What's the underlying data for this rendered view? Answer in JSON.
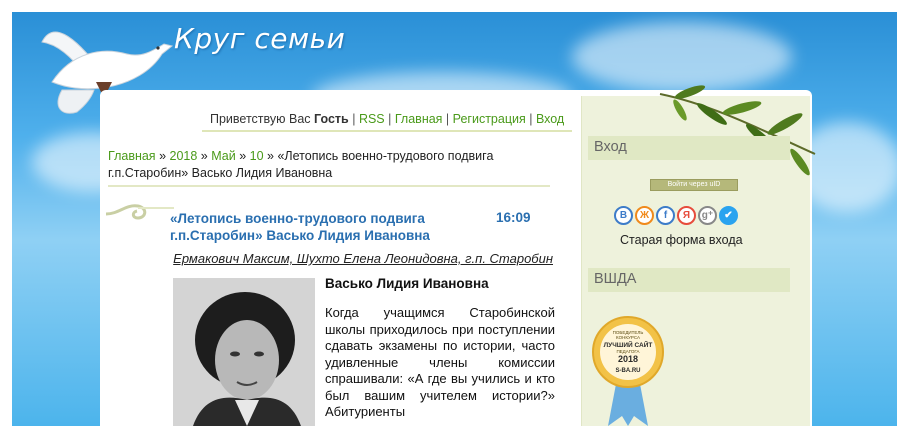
{
  "site": {
    "title": "Круг семьи"
  },
  "user_bar": {
    "greeting": "Приветствую Вас",
    "user": "Гость",
    "rss": "RSS",
    "home": "Главная",
    "register": "Регистрация",
    "login": "Вход",
    "sep": "|"
  },
  "breadcrumb": {
    "home": "Главная",
    "year": "2018",
    "month": "Май",
    "day": "10",
    "sep": "»",
    "current": "«Летопись военно-трудового подвига г.п.Старобин» Васько Лидия Ивановна"
  },
  "entry": {
    "title": "«Летопись военно-трудового подвига г.п.Старобин» Васько Лидия Ивановна",
    "time": "16:09",
    "authors": "Ермакович Максим, Шухто Елена Леонидовна, г.п. Старобин",
    "heading": "Васько Лидия Ивановна",
    "body": "Когда учащимся Старобинской школы приходилось при поступлении сдавать экзамены по истории, часто удивленные члены комиссии спрашивали: «А где вы учились и кто был вашим учителем истории?» Абитуриенты"
  },
  "sidebar": {
    "login_heading": "Вход",
    "ucoz_button": "Войти через uID",
    "social_icons": [
      {
        "name": "vk-icon",
        "glyph": "В",
        "cls": "vk"
      },
      {
        "name": "odnoklassniki-icon",
        "glyph": "Ж",
        "cls": "or"
      },
      {
        "name": "facebook-icon",
        "glyph": "f",
        "cls": "fb"
      },
      {
        "name": "yandex-icon",
        "glyph": "Я",
        "cls": "ya"
      },
      {
        "name": "google-plus-icon",
        "glyph": "g⁺",
        "cls": "gp"
      },
      {
        "name": "twitter-icon",
        "glyph": "✔",
        "cls": "tw"
      }
    ],
    "old_login": "Старая форма входа",
    "vshda_heading": "ВШДА",
    "badge": {
      "line1": "ПОБЕДИТЕЛЬ",
      "line2": "КОНКУРСА",
      "line3": "ЛУЧШИЙ САЙТ",
      "line4": "ПЕДАГОГА",
      "year": "2018",
      "site": "S-BA.RU"
    }
  },
  "colors": {
    "link_green": "#4a9a1a",
    "title_blue": "#2a6fb0",
    "sidebar_bg": "#eef2dc",
    "sky": "#4fb0ec"
  }
}
